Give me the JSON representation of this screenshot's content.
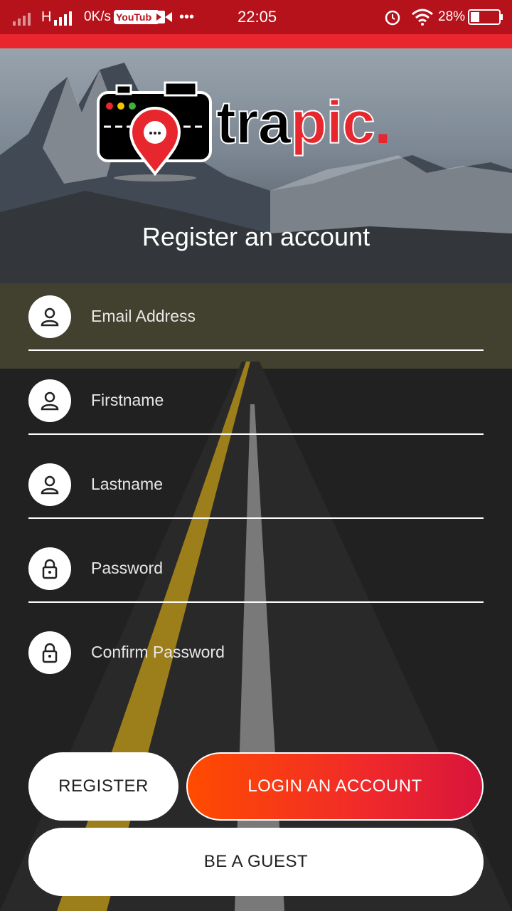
{
  "status_bar": {
    "network": "H",
    "speed": "0K/s",
    "youtube": "YouTube",
    "more": "•••",
    "time": "22:05",
    "battery": "28%"
  },
  "brand": {
    "name_part1": "tra",
    "name_part2": "pic",
    "name_dot": "."
  },
  "page": {
    "title": "Register an account"
  },
  "form": {
    "fields": [
      {
        "label": "Email Address",
        "icon": "person-icon"
      },
      {
        "label": "Firstname",
        "icon": "person-icon"
      },
      {
        "label": "Lastname",
        "icon": "person-icon"
      },
      {
        "label": "Password",
        "icon": "lock-icon"
      },
      {
        "label": "Confirm Password",
        "icon": "lock-icon"
      }
    ]
  },
  "buttons": {
    "register": "REGISTER",
    "login": "LOGIN AN ACCOUNT",
    "guest": "BE A GUEST"
  },
  "colors": {
    "status_bar": "#b5121b",
    "accent_red": "#e8262d",
    "gradient_start": "#ff4b00",
    "gradient_end": "#d9143c"
  }
}
